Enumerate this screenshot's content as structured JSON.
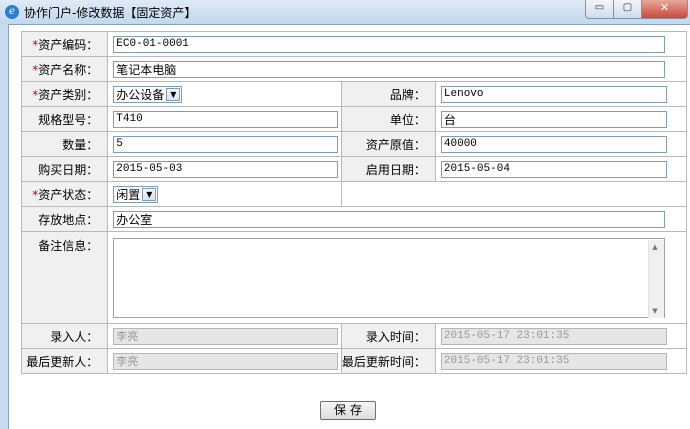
{
  "window": {
    "title": "协作门户-修改数据【固定资产】",
    "icon": "ie-browser-icon",
    "buttons": {
      "minimize": "▭",
      "maximize": "▢",
      "close": "✕"
    }
  },
  "form": {
    "asset_code": {
      "label": "资产编码：",
      "value": "EC0-01-0001",
      "required": true
    },
    "asset_name": {
      "label": "资产名称：",
      "value": "笔记本电脑",
      "required": true
    },
    "asset_category": {
      "label": "资产类别：",
      "value": "办公设备",
      "required": true
    },
    "brand": {
      "label": "品牌：",
      "value": "Lenovo"
    },
    "model": {
      "label": "规格型号：",
      "value": "T410"
    },
    "unit": {
      "label": "单位：",
      "value": "台"
    },
    "quantity": {
      "label": "数量：",
      "value": "5"
    },
    "original_value": {
      "label": "资产原值：",
      "value": "40000"
    },
    "purchase_date": {
      "label": "购买日期：",
      "value": "2015-05-03"
    },
    "start_date": {
      "label": "启用日期：",
      "value": "2015-05-04"
    },
    "asset_status": {
      "label": "资产状态：",
      "value": "闲置",
      "required": true
    },
    "location": {
      "label": "存放地点：",
      "value": "办公室"
    },
    "remarks": {
      "label": "备注信息：",
      "value": ""
    },
    "entered_by": {
      "label": "录入人：",
      "value": "李亮"
    },
    "entered_time": {
      "label": "录入时间：",
      "value": "2015-05-17 23:01:35"
    },
    "last_updated_by": {
      "label": "最后更新人：",
      "value": "李亮"
    },
    "last_updated_time": {
      "label": "最后更新时间：",
      "value": "2015-05-17 23:01:35"
    }
  },
  "required_mark": "*",
  "actions": {
    "save_label": "保存"
  },
  "colors": {
    "required": "#cc0000",
    "label_bg": "#f0f0f0",
    "border": "#b8b8b8"
  }
}
